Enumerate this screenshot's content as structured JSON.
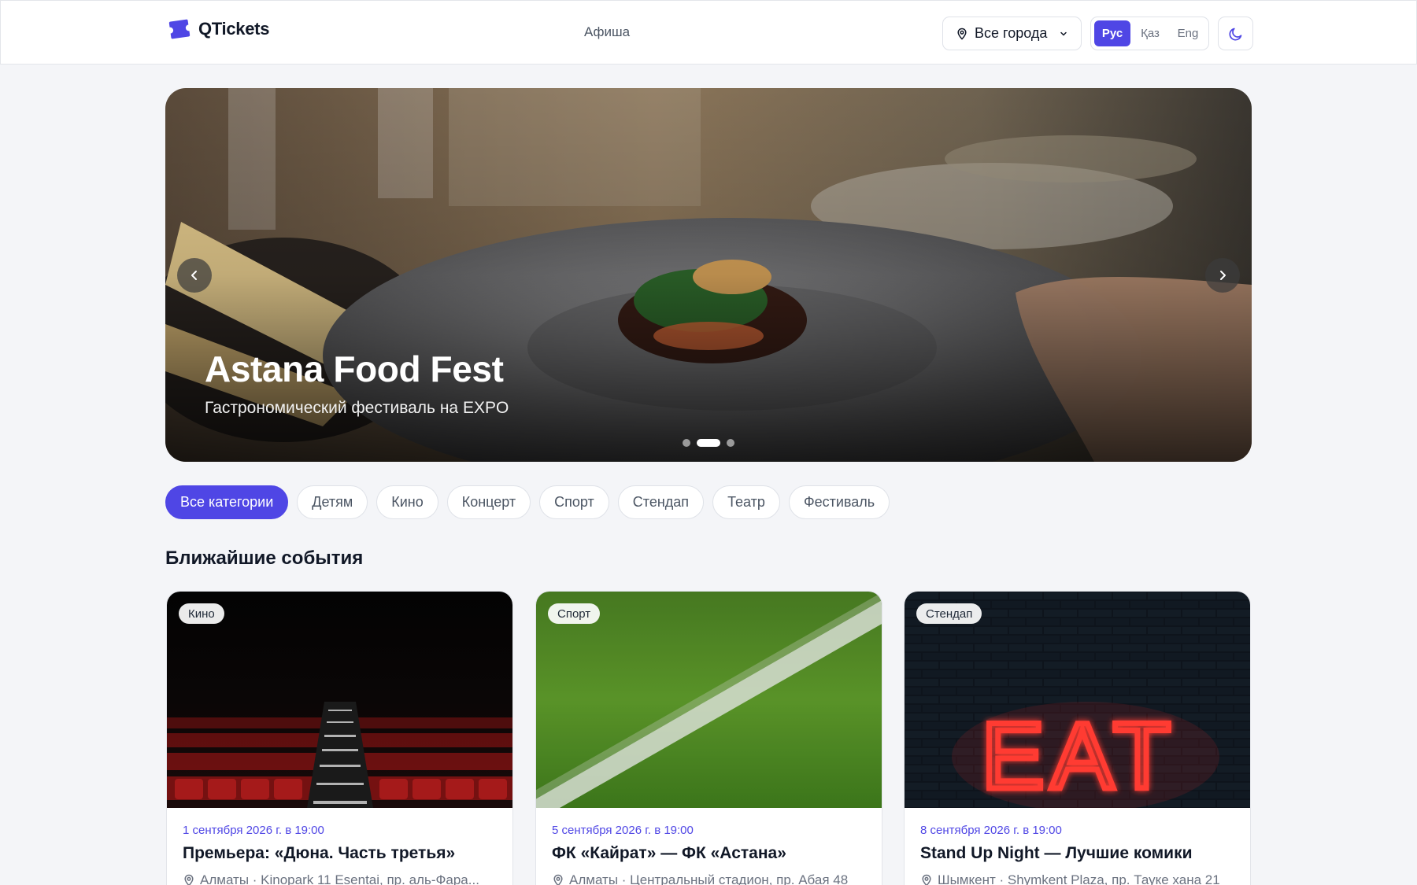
{
  "header": {
    "logo_text": "QTickets",
    "nav_link": "Афиша",
    "city_select": "Все города",
    "languages": [
      {
        "label": "Рус",
        "active": true
      },
      {
        "label": "Қаз",
        "active": false
      },
      {
        "label": "Eng",
        "active": false
      }
    ],
    "theme_icon": "moon-icon"
  },
  "hero": {
    "title": "Astana Food Fest",
    "subtitle": "Гастрономический фестиваль на EXPO",
    "slides_total": 3,
    "active_slide": 2
  },
  "categories": [
    {
      "label": "Все категории",
      "active": true
    },
    {
      "label": "Детям"
    },
    {
      "label": "Кино"
    },
    {
      "label": "Концерт"
    },
    {
      "label": "Спорт"
    },
    {
      "label": "Стендап"
    },
    {
      "label": "Театр"
    },
    {
      "label": "Фестиваль"
    }
  ],
  "section_title": "Ближайшие события",
  "events": [
    {
      "badge": "Кино",
      "date": "1 сентября 2026 г. в 19:00",
      "title": "Премьера: «Дюна. Часть третья»",
      "location": "Алматы · Kinopark 11 Esentai, пр. аль-Фара..."
    },
    {
      "badge": "Спорт",
      "date": "5 сентября 2026 г. в 19:00",
      "title": "ФК «Кайрат» — ФК «Астана»",
      "location": "Алматы · Центральный стадион, пр. Абая 48"
    },
    {
      "badge": "Стендап",
      "date": "8 сентября 2026 г. в 19:00",
      "title": "Stand Up Night — Лучшие комики",
      "location": "Шымкент · Shymkent Plaza, пр. Тауке хана 21",
      "neon_sign": "EAT"
    }
  ],
  "colors": {
    "accent": "#4f46e5",
    "background": "#f4f5f8",
    "text": "#111827",
    "muted": "#6b7280"
  }
}
